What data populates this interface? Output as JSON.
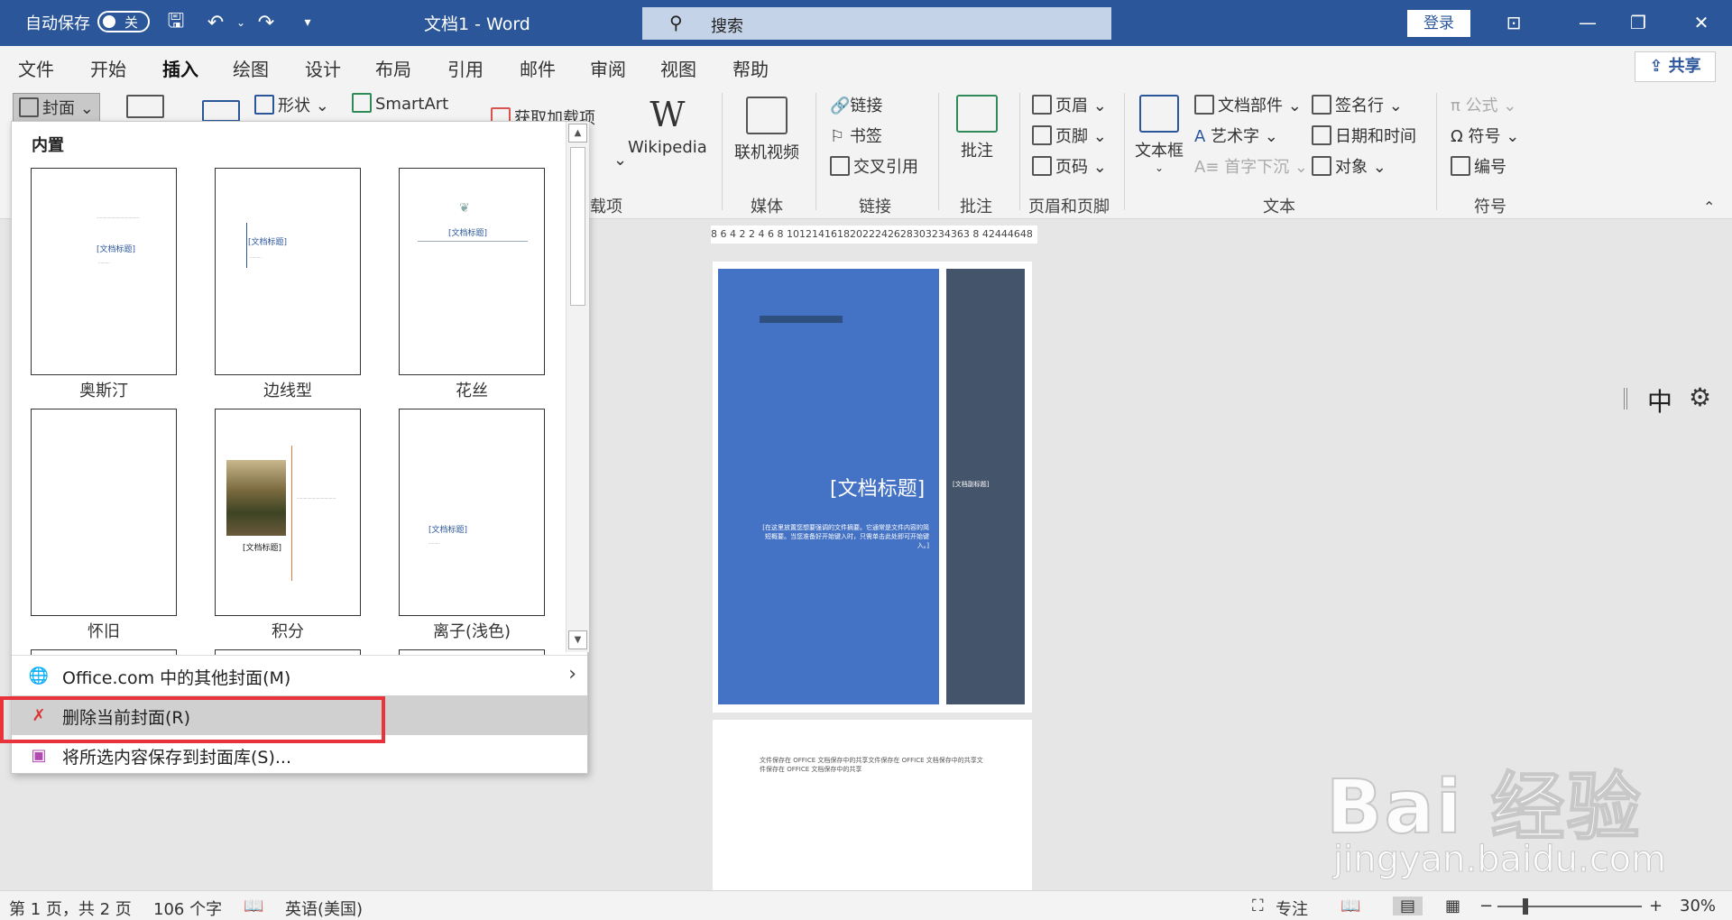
{
  "titlebar": {
    "autosave_label": "自动保存",
    "autosave_state": "关",
    "doc_title": "文档1  -  Word",
    "search_placeholder": "搜索",
    "login_label": "登录"
  },
  "tabs": [
    "文件",
    "开始",
    "插入",
    "绘图",
    "设计",
    "布局",
    "引用",
    "邮件",
    "审阅",
    "视图",
    "帮助"
  ],
  "active_tab": "插入",
  "share_label": "共享",
  "ribbon": {
    "cover_button": "封面",
    "shapes": "形状",
    "smartart": "SmartArt",
    "get_addins": "获取加载项",
    "addins_group": "载项",
    "wikipedia": "Wikipedia",
    "online_video": "联机视频",
    "media_group": "媒体",
    "link": "链接",
    "bookmark": "书签",
    "cross_ref": "交叉引用",
    "links_group": "链接",
    "comment": "批注",
    "comments_group": "批注",
    "header": "页眉",
    "footer": "页脚",
    "page_number": "页码",
    "header_footer_group": "页眉和页脚",
    "textbox": "文本框",
    "quick_parts": "文档部件",
    "wordart": "艺术字",
    "drop_cap": "首字下沉",
    "signature_line": "签名行",
    "date_time": "日期和时间",
    "object": "对象",
    "text_group": "文本",
    "equation": "公式",
    "symbol": "符号",
    "numbering": "编号",
    "symbols_group": "符号"
  },
  "dropdown": {
    "section_title": "内置",
    "covers": [
      {
        "name": "奥斯汀",
        "title": "[文档标题]"
      },
      {
        "name": "边线型",
        "title": "[文档标题]"
      },
      {
        "name": "花丝",
        "title": "[文档标题]"
      },
      {
        "name": "怀旧",
        "title": ""
      },
      {
        "name": "积分",
        "title": "[文档标题]"
      },
      {
        "name": "离子(浅色)",
        "title": "[文档标题]"
      }
    ],
    "menu": {
      "more_covers": "Office.com 中的其他封面(M)",
      "remove_cover": "删除当前封面(R)",
      "save_selection": "将所选内容保存到封面库(S)..."
    }
  },
  "ruler_text": "8  6  4  2     2  4  6  8 10121416182022242628303234363 8    42444648",
  "document": {
    "cover_title": "[文档标题]",
    "cover_subtitle": "[在这里放置您想要强调的文件摘要。它通常是文件内容的简短概要。当您准备好开始键入时，只需单击此处即可开始键入。]",
    "side_title": "[文档副标题]",
    "page2_text": "文件保存在 OFFICE 文档保存中的共享文件保存在 OFFICE 文档保存中的共享文件保存在 OFFICE 文档保存中的共享"
  },
  "ime": {
    "mode": "中"
  },
  "statusbar": {
    "page": "第 1 页，共 2 页",
    "words": "106 个字",
    "language": "英语(美国)",
    "focus": "专注",
    "zoom": "30%"
  },
  "watermark": {
    "brand": "Bai 经验",
    "url": "jingyan.baidu.com"
  },
  "colors": {
    "word_blue": "#2b579a",
    "cover_blue": "#4472c4",
    "cover_slate": "#44546a",
    "highlight_red": "#e8333a"
  }
}
